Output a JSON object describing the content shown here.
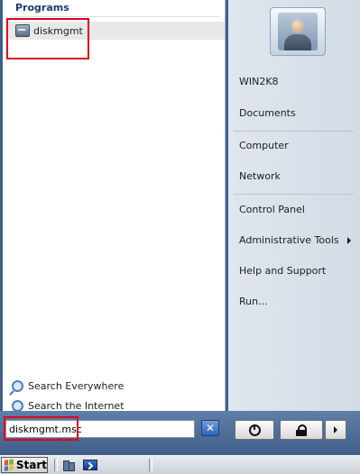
{
  "start_menu": {
    "programs": {
      "title": "Programs",
      "items": [
        {
          "label": "diskmgmt",
          "icon": "disk-management-icon"
        }
      ]
    },
    "search_links": [
      {
        "label": "Search Everywhere",
        "icon": "search-icon"
      },
      {
        "label": "Search the Internet",
        "icon": "search-icon"
      }
    ],
    "search_box": {
      "value": "diskmgmt.msc",
      "clear_label": "✕"
    },
    "right_pane": {
      "user_icon": "user-avatar",
      "items": [
        {
          "label": "WIN2K8"
        },
        {
          "label": "Documents"
        },
        {
          "label": "Computer"
        },
        {
          "label": "Network"
        },
        {
          "label": "Control Panel"
        },
        {
          "label": "Administrative Tools",
          "has_submenu": true
        },
        {
          "label": "Help and Support"
        },
        {
          "label": "Run..."
        }
      ]
    },
    "power_buttons": [
      "power-icon",
      "lock-icon",
      "arrow-right-icon"
    ],
    "highlight_color": "#e0001a"
  },
  "taskbar": {
    "start_label": "Start",
    "quick_launch": [
      "server-manager-icon",
      "powershell-icon"
    ]
  }
}
